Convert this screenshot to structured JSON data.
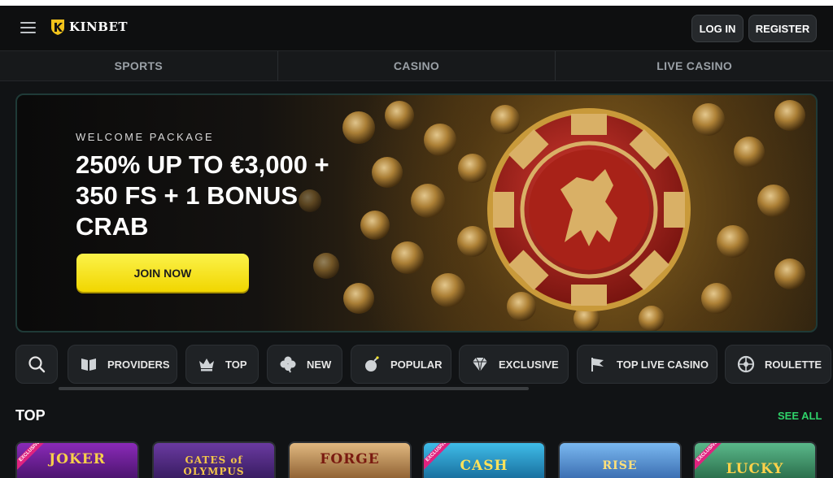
{
  "header": {
    "brand": "KINBET",
    "login_label": "LOG IN",
    "register_label": "REGISTER"
  },
  "main_nav": [
    "SPORTS",
    "CASINO",
    "LIVE CASINO"
  ],
  "banner": {
    "eyebrow": "WELCOME PACKAGE",
    "headline": "250% UP TO €3,000 + 350 FS + 1 BONUS CRAB",
    "cta": "JOIN NOW"
  },
  "categories": [
    {
      "label": "PROVIDERS",
      "icon": "book-icon"
    },
    {
      "label": "TOP",
      "icon": "crown-icon"
    },
    {
      "label": "NEW",
      "icon": "clover-icon"
    },
    {
      "label": "POPULAR",
      "icon": "bomb-icon"
    },
    {
      "label": "EXCLUSIVE",
      "icon": "diamond-icon"
    },
    {
      "label": "TOP LIVE CASINO",
      "icon": "flag-icon"
    },
    {
      "label": "ROULETTE",
      "icon": "roulette-icon"
    }
  ],
  "section": {
    "title": "TOP",
    "see_all": "SEE ALL"
  },
  "games": [
    {
      "title": "JOKER",
      "badge": "EXCLUSIVE",
      "color": "#7a1fa8"
    },
    {
      "title": "GATES of OLYMPUS",
      "badge": "",
      "color": "#5a2a8a"
    },
    {
      "title": "FORGE",
      "badge": "",
      "color": "#b87a3a"
    },
    {
      "title": "CASH",
      "badge": "EXCLUSIVE",
      "color": "#1a8ab8"
    },
    {
      "title": "RISE",
      "badge": "",
      "color": "#4a88c8"
    },
    {
      "title": "LUCKY",
      "badge": "EXCLUSIVE",
      "color": "#2e8a5a"
    }
  ],
  "colors": {
    "accent_yellow": "#f7e52a",
    "see_all_green": "#2fd36a",
    "background": "#111315"
  }
}
